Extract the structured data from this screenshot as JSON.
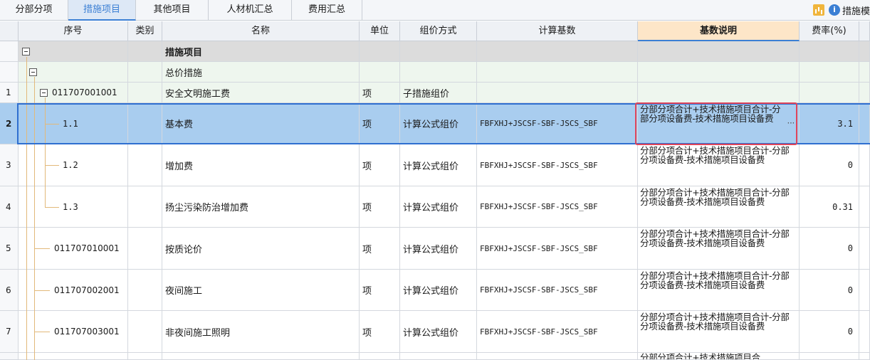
{
  "tabs": [
    "分部分项",
    "措施项目",
    "其他项目",
    "人材机汇总",
    "费用汇总"
  ],
  "tab_active": 1,
  "right_tool": {
    "label": "措施模"
  },
  "headers": {
    "seq": "序号",
    "type": "类别",
    "name": "名称",
    "unit": "单位",
    "pricing": "组价方式",
    "base": "计算基数",
    "basedesc": "基数说明",
    "rate": "费率(%)"
  },
  "rows": [
    {
      "idx": "",
      "code": "",
      "name": "措施项目",
      "unit": "",
      "pricing": "",
      "base": "",
      "desc": "",
      "rate": ""
    },
    {
      "idx": "",
      "code": "",
      "name": "总价措施",
      "unit": "",
      "pricing": "",
      "base": "",
      "desc": "",
      "rate": ""
    },
    {
      "idx": "1",
      "code": "011707001001",
      "name": "安全文明施工费",
      "unit": "项",
      "pricing": "子措施组价",
      "base": "",
      "desc": "",
      "rate": ""
    },
    {
      "idx": "2",
      "code": "1.1",
      "name": "基本费",
      "unit": "项",
      "pricing": "计算公式组价",
      "base": "FBFXHJ+JSCSF-SBF-JSCS_SBF",
      "desc": "分部分项合计+技术措施项目合计-分部分项设备费-技术措施项目设备费",
      "rate": "3.1"
    },
    {
      "idx": "3",
      "code": "1.2",
      "name": "增加费",
      "unit": "项",
      "pricing": "计算公式组价",
      "base": "FBFXHJ+JSCSF-SBF-JSCS_SBF",
      "desc": "分部分项合计+技术措施项目合计-分部分项设备费-技术措施项目设备费",
      "rate": "0"
    },
    {
      "idx": "4",
      "code": "1.3",
      "name": "扬尘污染防治增加费",
      "unit": "项",
      "pricing": "计算公式组价",
      "base": "FBFXHJ+JSCSF-SBF-JSCS_SBF",
      "desc": "分部分项合计+技术措施项目合计-分部分项设备费-技术措施项目设备费",
      "rate": "0.31"
    },
    {
      "idx": "5",
      "code": "011707010001",
      "name": "按质论价",
      "unit": "项",
      "pricing": "计算公式组价",
      "base": "FBFXHJ+JSCSF-SBF-JSCS_SBF",
      "desc": "分部分项合计+技术措施项目合计-分部分项设备费-技术措施项目设备费",
      "rate": "0"
    },
    {
      "idx": "6",
      "code": "011707002001",
      "name": "夜间施工",
      "unit": "项",
      "pricing": "计算公式组价",
      "base": "FBFXHJ+JSCSF-SBF-JSCS_SBF",
      "desc": "分部分项合计+技术措施项目合计-分部分项设备费-技术措施项目设备费",
      "rate": "0"
    },
    {
      "idx": "7",
      "code": "011707003001",
      "name": "非夜间施工照明",
      "unit": "项",
      "pricing": "计算公式组价",
      "base": "FBFXHJ+JSCSF-SBF-JSCS_SBF",
      "desc": "分部分项合计+技术措施项目合计-分部分项设备费-技术措施项目设备费",
      "rate": "0"
    }
  ],
  "partial_row_desc": "分部分项合计+技术措施项目合",
  "selected_row": 3,
  "colors": {
    "accent": "#3b7fd4",
    "selection": "#a9cdef",
    "highlight_box": "#e0455a",
    "header_highlight": "#fde6c8"
  }
}
